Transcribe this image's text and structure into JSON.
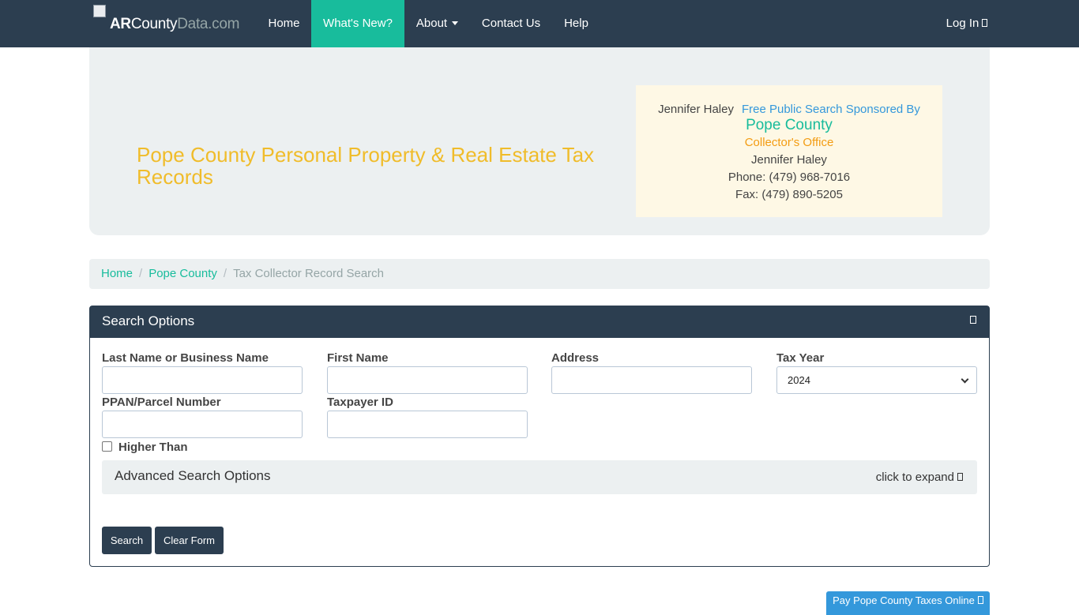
{
  "nav": {
    "brand_bold": "AR",
    "brand_mid": "County",
    "brand_muted": "Data.com",
    "items": [
      {
        "label": "Home"
      },
      {
        "label": "What's New?"
      },
      {
        "label": "About"
      },
      {
        "label": "Contact Us"
      },
      {
        "label": "Help"
      }
    ],
    "login": "Log In",
    "active_color": "#18bc9c",
    "bg_color": "#2c3e50"
  },
  "header": {
    "title": "Pope County Personal Property & Real Estate Tax Records",
    "sponsor": {
      "image_alt": "Jennifer Haley",
      "label": "Free Public Search Sponsored By",
      "county": "Pope County",
      "office": "Collector's Office",
      "name": "Jennifer Haley",
      "phone": "Phone: (479) 968-7016",
      "fax": "Fax: (479) 890-5205"
    }
  },
  "breadcrumb": {
    "home": "Home",
    "county": "Pope County",
    "current": "Tax Collector Record Search",
    "separator": "/"
  },
  "search": {
    "title": "Search Options",
    "fields": {
      "last_name": {
        "label": "Last Name or Business Name",
        "value": ""
      },
      "first_name": {
        "label": "First Name",
        "value": ""
      },
      "address": {
        "label": "Address",
        "value": ""
      },
      "tax_year": {
        "label": "Tax Year",
        "value": "2024"
      },
      "parcel": {
        "label": "PPAN/Parcel Number",
        "value": ""
      },
      "taxpayer_id": {
        "label": "Taxpayer ID",
        "value": ""
      }
    },
    "higher_than": "Higher Than",
    "advanced_title": "Advanced Search Options",
    "advanced_hint": "click to expand",
    "search_button": "Search",
    "clear_button": "Clear Form"
  },
  "pay_button": "Pay Pope County Taxes Online"
}
